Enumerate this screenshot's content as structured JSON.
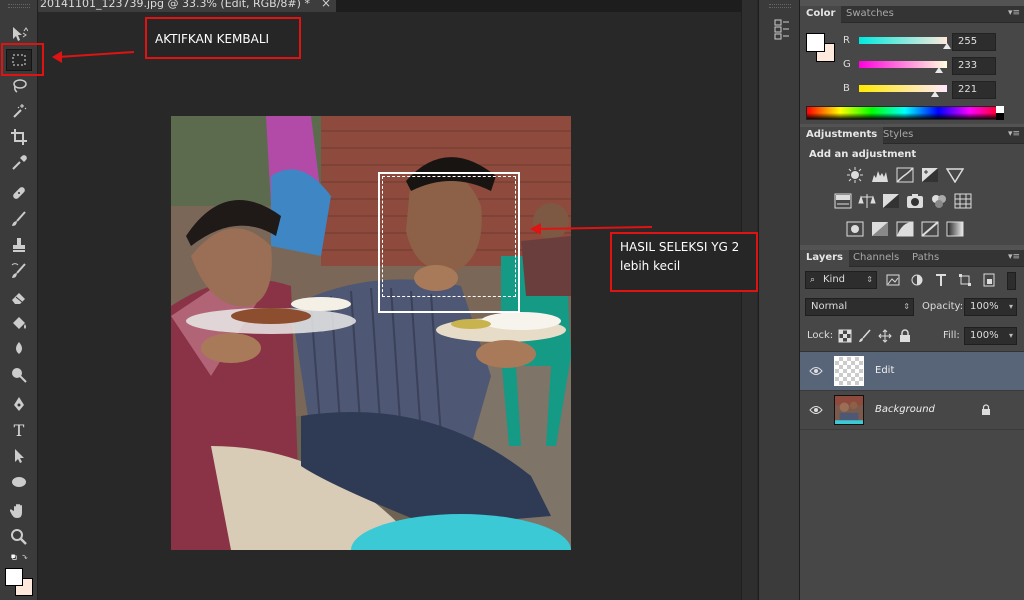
{
  "document": {
    "tab_title": "20141101_123739.jpg @ 33.3% (Edit, RGB/8#) *",
    "close_glyph": "×"
  },
  "annotations": {
    "aktifkan": "AKTIFKAN KEMBALI",
    "hasil_line1": "HASIL SELEKSI YG 2",
    "hasil_line2": "lebih kecil",
    "accent_color": "#e01313"
  },
  "tools": [
    "move-tool-icon",
    "rectangular-marquee-icon",
    "lasso-icon",
    "magic-wand-icon",
    "crop-icon",
    "eyedropper-icon",
    "healing-brush-icon",
    "brush-icon",
    "clone-stamp-icon",
    "history-brush-icon",
    "eraser-icon",
    "paint-bucket-icon",
    "blur-icon",
    "dodge-icon",
    "pen-icon",
    "type-icon",
    "path-selection-icon",
    "ellipse-icon",
    "hand-icon",
    "zoom-icon"
  ],
  "type_tool_glyph": "T",
  "color_panel": {
    "tabs": [
      "Color",
      "Swatches"
    ],
    "foreground": "#ffffff",
    "background": "#ffe9dd",
    "channels": [
      {
        "label": "R",
        "value": "255",
        "fraction": 1.0,
        "gradient": "linear-gradient(to right, #00e9dd, #ffe9dd)"
      },
      {
        "label": "G",
        "value": "233",
        "fraction": 0.914,
        "gradient": "linear-gradient(to right, #ff00dd, #ffffdd)"
      },
      {
        "label": "B",
        "value": "221",
        "fraction": 0.867,
        "gradient": "linear-gradient(to right, #ffe900, #ffe9ff)"
      }
    ]
  },
  "adjustments_panel": {
    "tabs": [
      "Adjustments",
      "Styles"
    ],
    "heading": "Add an adjustment"
  },
  "layers_panel": {
    "tabs": [
      "Layers",
      "Channels",
      "Paths"
    ],
    "filter_kind": "Kind",
    "blend_mode": "Normal",
    "opacity_label": "Opacity:",
    "opacity_value": "100%",
    "lock_label": "Lock:",
    "fill_label": "Fill:",
    "fill_value": "100%",
    "layers": [
      {
        "name": "Edit",
        "selected": true,
        "visible": true,
        "locked": false
      },
      {
        "name": "Background",
        "selected": false,
        "visible": true,
        "locked": true
      }
    ]
  }
}
